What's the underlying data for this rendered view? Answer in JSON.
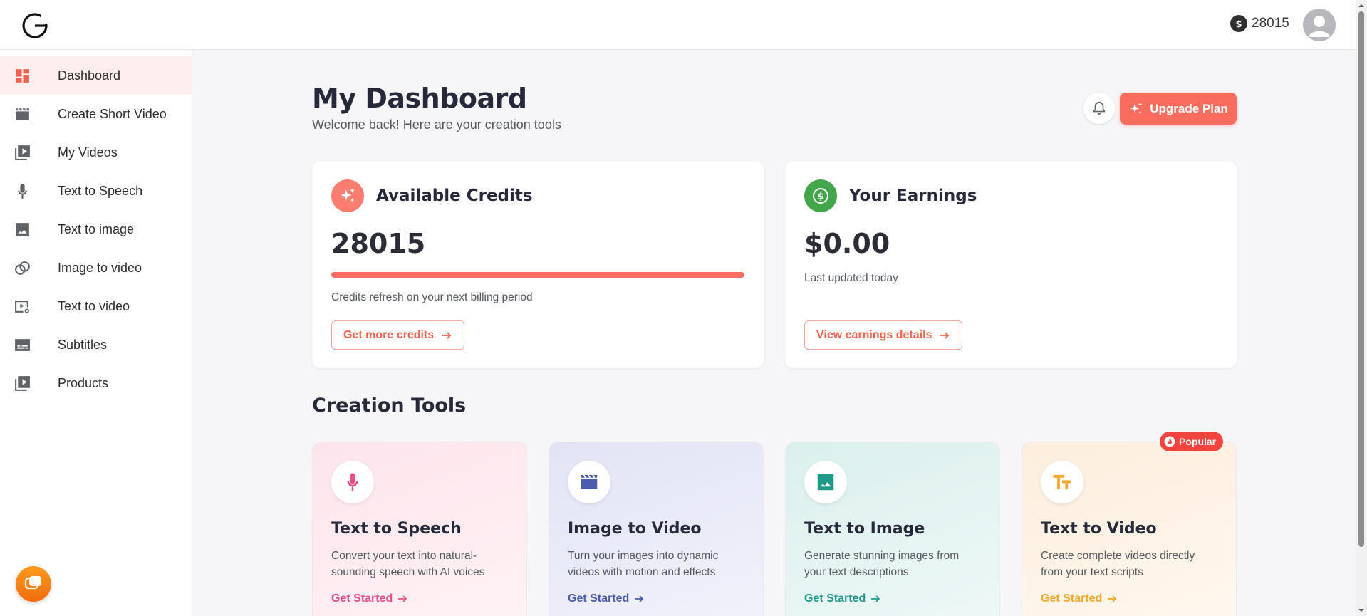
{
  "header": {
    "credits": "28015"
  },
  "sidebar": {
    "items": [
      {
        "label": "Dashboard",
        "icon": "dashboard-icon"
      },
      {
        "label": "Create Short Video",
        "icon": "clapperboard-icon"
      },
      {
        "label": "My Videos",
        "icon": "video-library-icon"
      },
      {
        "label": "Text to Speech",
        "icon": "microphone-icon"
      },
      {
        "label": "Text to image",
        "icon": "image-icon"
      },
      {
        "label": "Image to video",
        "icon": "image-to-video-icon"
      },
      {
        "label": "Text to video",
        "icon": "video-settings-icon"
      },
      {
        "label": "Subtitles",
        "icon": "subtitles-icon"
      },
      {
        "label": "Products",
        "icon": "products-icon"
      }
    ],
    "active_index": 0
  },
  "main": {
    "title": "My Dashboard",
    "subtitle": "Welcome back! Here are your creation tools",
    "upgrade_label": "Upgrade Plan",
    "credits_card": {
      "title": "Available Credits",
      "value": "28015",
      "progress": 1.0,
      "note": "Credits refresh on your next billing period",
      "button": "Get more credits"
    },
    "earnings_card": {
      "title": "Your Earnings",
      "value": "$0.00",
      "note": "Last updated today",
      "button": "View earnings details"
    },
    "section_title": "Creation Tools",
    "popular_label": "Popular",
    "tools": [
      {
        "title": "Text to Speech",
        "desc": "Convert your text into natural-sounding speech with AI voices",
        "link": "Get Started",
        "icon": "microphone-icon",
        "accent": "#e94c89"
      },
      {
        "title": "Image to Video",
        "desc": "Turn your images into dynamic videos with motion and effects",
        "link": "Get Started",
        "icon": "clapperboard-icon",
        "accent": "#4a5bb0"
      },
      {
        "title": "Text to Image",
        "desc": "Generate stunning images from your text descriptions",
        "link": "Get Started",
        "icon": "image-icon",
        "accent": "#1e9a8a"
      },
      {
        "title": "Text to Video",
        "desc": "Create complete videos directly from your text scripts",
        "link": "Get Started",
        "icon": "text-fields-icon",
        "accent": "#f4a72b"
      }
    ]
  },
  "colors": {
    "brand": "#fa6c5e",
    "earnings": "#43a64a",
    "active_nav_bg": "#ffeeed",
    "popular": "#f1443f"
  }
}
